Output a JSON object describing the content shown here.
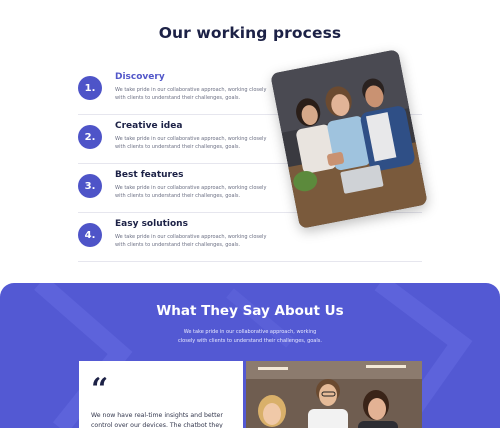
{
  "process": {
    "title": "Our  working process",
    "steps": [
      {
        "number": "1.",
        "title": "Discovery",
        "desc": "We take pride in our collaborative approach, working closely with  clients to understand their challenges, goals."
      },
      {
        "number": "2.",
        "title": "Creative idea",
        "desc": "We take pride in our collaborative approach, working closely with  clients to understand their challenges, goals."
      },
      {
        "number": "3.",
        "title": "Best features",
        "desc": "We take pride in our collaborative approach, working closely with  clients to understand their challenges, goals."
      },
      {
        "number": "4.",
        "title": "Easy solutions",
        "desc": "We take pride in our collaborative approach, working closely with  clients to understand their challenges, goals."
      }
    ]
  },
  "testimonials": {
    "title": "What They Say About Us",
    "desc": "We take pride in our collaborative approach, working closely with clients to understand their challenges, goals.",
    "quote_icon": "“",
    "quote_text": "We now have real-time insights and better control over our devices. The chatbot they"
  },
  "colors": {
    "accent": "#4e54c8",
    "section_bg": "#5359d3",
    "heading": "#1c2146"
  }
}
